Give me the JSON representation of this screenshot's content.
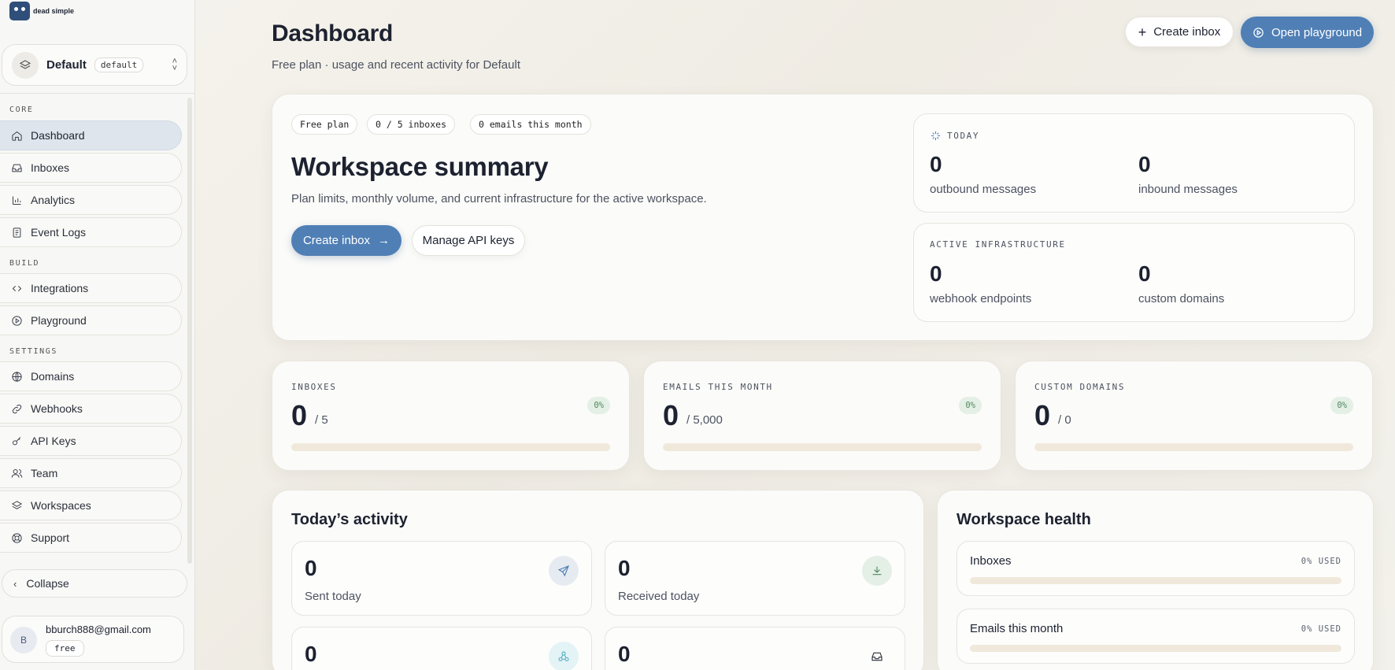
{
  "brand": {
    "name": "dead simple"
  },
  "workspace_switcher": {
    "name": "Default",
    "slug": "default"
  },
  "nav": {
    "sections": {
      "core": "CORE",
      "build": "BUILD",
      "settings": "SETTINGS"
    },
    "items": {
      "dashboard": "Dashboard",
      "inboxes": "Inboxes",
      "analytics": "Analytics",
      "event_logs": "Event Logs",
      "integrations": "Integrations",
      "playground": "Playground",
      "domains": "Domains",
      "webhooks": "Webhooks",
      "api_keys": "API Keys",
      "team": "Team",
      "workspaces": "Workspaces",
      "support": "Support"
    },
    "active": "dashboard",
    "collapse": "Collapse"
  },
  "user": {
    "initial": "B",
    "email": "bburch888@gmail.com",
    "plan": "free"
  },
  "header": {
    "title": "Dashboard",
    "subtitle": "Free plan · usage and recent activity for Default",
    "create_inbox": "Create inbox",
    "open_playground": "Open playground"
  },
  "summary": {
    "chips": [
      "Free plan",
      "0 / 5 inboxes",
      "0 emails this month"
    ],
    "title": "Workspace summary",
    "description": "Plan limits, monthly volume, and current infrastructure for the active workspace.",
    "create_inbox": "Create inbox",
    "manage_api_keys": "Manage API keys",
    "today": {
      "label": "TODAY",
      "outbound_value": "0",
      "outbound_label": "outbound messages",
      "inbound_value": "0",
      "inbound_label": "inbound messages"
    },
    "infrastructure": {
      "label": "ACTIVE INFRASTRUCTURE",
      "webhooks_value": "0",
      "webhooks_label": "webhook endpoints",
      "domains_value": "0",
      "domains_label": "custom domains"
    }
  },
  "metrics": [
    {
      "label": "INBOXES",
      "value": "0",
      "limit": "/ 5",
      "percent_label": "0%",
      "fraction": 0
    },
    {
      "label": "EMAILS THIS MONTH",
      "value": "0",
      "limit": "/ 5,000",
      "percent_label": "0%",
      "fraction": 0
    },
    {
      "label": "CUSTOM DOMAINS",
      "value": "0",
      "limit": "/ 0",
      "percent_label": "0%",
      "fraction": 0
    }
  ],
  "activity": {
    "title": "Today’s activity",
    "tiles": [
      {
        "value": "0",
        "label": "Sent today",
        "icon": "send-icon"
      },
      {
        "value": "0",
        "label": "Received today",
        "icon": "download-icon"
      },
      {
        "value": "0",
        "icon": "webhook-icon"
      },
      {
        "value": "0",
        "icon": "inbox-icon"
      }
    ]
  },
  "health": {
    "title": "Workspace health",
    "rows": [
      {
        "name": "Inboxes",
        "used": "0% USED",
        "fraction": 0
      },
      {
        "name": "Emails this month",
        "used": "0% USED",
        "fraction": 0
      }
    ]
  },
  "colors": {
    "accent": "#4f7fb5",
    "success_bg": "#e4efe6",
    "success_text": "#4f8a60",
    "track": "#f0e9db"
  }
}
